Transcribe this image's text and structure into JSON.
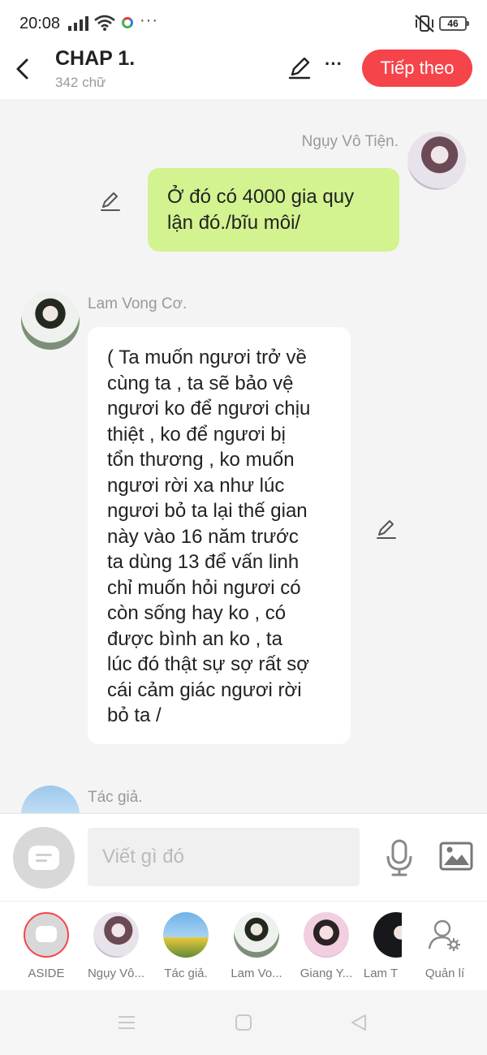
{
  "status_bar": {
    "time": "20:08",
    "battery": "46"
  },
  "header": {
    "title": "CHAP 1.",
    "word_count": "342 chữ",
    "next_label": "Tiếp theo"
  },
  "messages": [
    {
      "speaker": "Ngụy Vô Tiện.",
      "side": "right",
      "text_lines": [
        "Ở đó có 4000 gia quy",
        "lận đó./bĩu môi/"
      ]
    },
    {
      "speaker": "Lam Vong Cơ.",
      "side": "left",
      "text_lines": [
        "( Ta muốn ngươi trở về",
        "cùng ta , ta sẽ bảo vệ",
        "ngươi ko để ngươi chịu",
        "thiệt , ko để ngươi bị",
        "tổn thương , ko muốn",
        "ngươi rời xa như lúc",
        "ngươi bỏ ta lại thế gian",
        "này vào 16 năm trước",
        "ta dùng 13 để vấn linh",
        "chỉ muốn hỏi ngươi có",
        "còn sống hay ko , có",
        "được bình an ko , ta",
        "lúc đó thật sự sợ rất sợ",
        "cái cảm giác ngươi rời",
        "bỏ ta /"
      ]
    },
    {
      "speaker": "Tác giả.",
      "side": "left"
    }
  ],
  "composer": {
    "placeholder": "Viết gì đó"
  },
  "characters": [
    {
      "label": "ASIDE"
    },
    {
      "label": "Ngụy Vô..."
    },
    {
      "label": "Tác giả."
    },
    {
      "label": "Lam Vo..."
    },
    {
      "label": "Giang Y..."
    },
    {
      "label": "Lam T"
    },
    {
      "label": "Quản lí"
    }
  ],
  "colors": {
    "accent": "#f5444a",
    "bubble_green": "#d2f390",
    "bubble_white": "#ffffff"
  }
}
